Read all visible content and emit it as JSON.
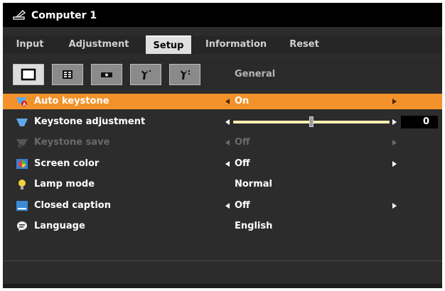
{
  "window": {
    "title": "Computer 1",
    "icon": "pen-icon"
  },
  "menu_tabs": [
    {
      "label": "Input"
    },
    {
      "label": "Adjustment"
    },
    {
      "label": "Setup",
      "active": true
    },
    {
      "label": "Information"
    },
    {
      "label": "Reset"
    }
  ],
  "sub_tabs": {
    "icons": [
      "page-icon",
      "list-icon",
      "projector-icon",
      "wrench-icon",
      "wrench-icon"
    ],
    "active_index": 0,
    "current": "General"
  },
  "rows": [
    {
      "label": "Auto keystone",
      "value": "On",
      "selected": true,
      "icon": "auto-keystone-icon"
    },
    {
      "label": "Keystone adjustment",
      "slider_value": "0",
      "slider_fraction": 0.5,
      "icon": "keystone-icon"
    },
    {
      "label": "Keystone save",
      "value": "Off",
      "disabled": true,
      "icon": "keystone-save-icon"
    },
    {
      "label": "Screen color",
      "value": "Off",
      "icon": "screen-color-icon"
    },
    {
      "label": "Lamp mode",
      "value": "Normal",
      "icon": "lamp-icon"
    },
    {
      "label": "Closed caption",
      "value": "Off",
      "icon": "closed-caption-icon"
    },
    {
      "label": "Language",
      "value": "English",
      "icon": "language-icon"
    }
  ],
  "colors": {
    "selected_row": "#f3922a",
    "background": "#2c2c2c",
    "slider_track": "#f5f0b0"
  }
}
